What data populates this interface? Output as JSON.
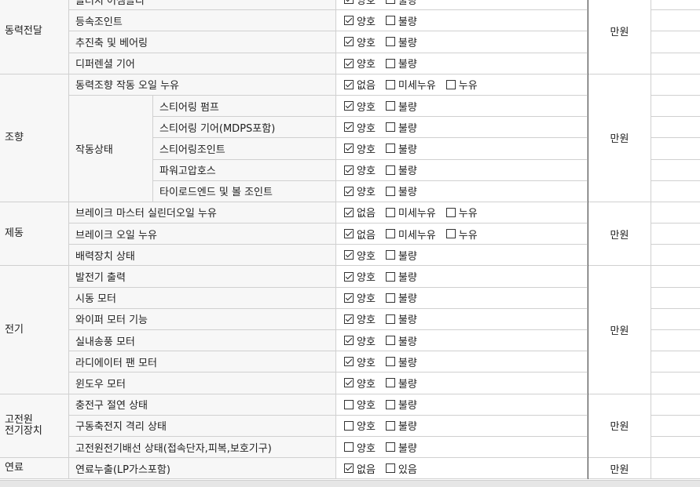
{
  "groups": [
    {
      "name": "동력전달",
      "cost": "만원"
    },
    {
      "name": "조향",
      "cost": "만원"
    },
    {
      "name": "제동",
      "cost": "만원"
    },
    {
      "name": "전기",
      "cost": "만원"
    },
    {
      "name": "고전원\n전기장치",
      "cost": "만원"
    },
    {
      "name": "연료",
      "cost": "만원"
    }
  ],
  "subgroups": [
    {
      "name": "작동상태"
    }
  ],
  "rows": [
    {
      "group": 0,
      "label": "클러치 어셈블리",
      "options": [
        {
          "label": "양호",
          "checked": true
        },
        {
          "label": "불량",
          "checked": false
        }
      ]
    },
    {
      "group": 0,
      "label": "등속조인트",
      "options": [
        {
          "label": "양호",
          "checked": true
        },
        {
          "label": "불량",
          "checked": false
        }
      ]
    },
    {
      "group": 0,
      "label": "추진축 및 베어링",
      "options": [
        {
          "label": "양호",
          "checked": true
        },
        {
          "label": "불량",
          "checked": false
        }
      ]
    },
    {
      "group": 0,
      "label": "디퍼렌셜 기어",
      "options": [
        {
          "label": "양호",
          "checked": true
        },
        {
          "label": "불량",
          "checked": false
        }
      ]
    },
    {
      "group": 1,
      "label": "동력조향 작동 오일 누유",
      "options": [
        {
          "label": "없음",
          "checked": true
        },
        {
          "label": "미세누유",
          "checked": false
        },
        {
          "label": "누유",
          "checked": false
        }
      ]
    },
    {
      "group": 1,
      "sub": 0,
      "label": "스티어링 펌프",
      "options": [
        {
          "label": "양호",
          "checked": true
        },
        {
          "label": "불량",
          "checked": false
        }
      ]
    },
    {
      "group": 1,
      "sub": 0,
      "label": "스티어링 기어(MDPS포함)",
      "options": [
        {
          "label": "양호",
          "checked": true
        },
        {
          "label": "불량",
          "checked": false
        }
      ]
    },
    {
      "group": 1,
      "sub": 0,
      "label": "스티어링조인트",
      "options": [
        {
          "label": "양호",
          "checked": true
        },
        {
          "label": "불량",
          "checked": false
        }
      ]
    },
    {
      "group": 1,
      "sub": 0,
      "label": "파워고압호스",
      "options": [
        {
          "label": "양호",
          "checked": true
        },
        {
          "label": "불량",
          "checked": false
        }
      ]
    },
    {
      "group": 1,
      "sub": 0,
      "label": "타이로드엔드 및 볼 조인트",
      "options": [
        {
          "label": "양호",
          "checked": true
        },
        {
          "label": "불량",
          "checked": false
        }
      ]
    },
    {
      "group": 2,
      "label": "브레이크 마스터 실린더오일 누유",
      "options": [
        {
          "label": "없음",
          "checked": true
        },
        {
          "label": "미세누유",
          "checked": false
        },
        {
          "label": "누유",
          "checked": false
        }
      ]
    },
    {
      "group": 2,
      "label": "브레이크 오일 누유",
      "options": [
        {
          "label": "없음",
          "checked": true
        },
        {
          "label": "미세누유",
          "checked": false
        },
        {
          "label": "누유",
          "checked": false
        }
      ]
    },
    {
      "group": 2,
      "label": "배력장치 상태",
      "options": [
        {
          "label": "양호",
          "checked": true
        },
        {
          "label": "불량",
          "checked": false
        }
      ]
    },
    {
      "group": 3,
      "label": "발전기 출력",
      "options": [
        {
          "label": "양호",
          "checked": true
        },
        {
          "label": "불량",
          "checked": false
        }
      ]
    },
    {
      "group": 3,
      "label": "시동 모터",
      "options": [
        {
          "label": "양호",
          "checked": true
        },
        {
          "label": "불량",
          "checked": false
        }
      ]
    },
    {
      "group": 3,
      "label": "와이퍼 모터 기능",
      "options": [
        {
          "label": "양호",
          "checked": true
        },
        {
          "label": "불량",
          "checked": false
        }
      ]
    },
    {
      "group": 3,
      "label": "실내송풍 모터",
      "options": [
        {
          "label": "양호",
          "checked": true
        },
        {
          "label": "불량",
          "checked": false
        }
      ]
    },
    {
      "group": 3,
      "label": "라디에이터 팬 모터",
      "options": [
        {
          "label": "양호",
          "checked": true
        },
        {
          "label": "불량",
          "checked": false
        }
      ]
    },
    {
      "group": 3,
      "label": "윈도우 모터",
      "options": [
        {
          "label": "양호",
          "checked": true
        },
        {
          "label": "불량",
          "checked": false
        }
      ]
    },
    {
      "group": 4,
      "label": "충전구 절연 상태",
      "options": [
        {
          "label": "양호",
          "checked": false
        },
        {
          "label": "불량",
          "checked": false
        }
      ]
    },
    {
      "group": 4,
      "label": "구동축전지 격리 상태",
      "options": [
        {
          "label": "양호",
          "checked": false
        },
        {
          "label": "불량",
          "checked": false
        }
      ]
    },
    {
      "group": 4,
      "label": "고전원전기배선 상태(접속단자,피복,보호기구)",
      "options": [
        {
          "label": "양호",
          "checked": false
        },
        {
          "label": "불량",
          "checked": false
        }
      ]
    },
    {
      "group": 5,
      "label": "연료누출(LP가스포함)",
      "options": [
        {
          "label": "없음",
          "checked": true
        },
        {
          "label": "있음",
          "checked": false
        }
      ]
    }
  ]
}
